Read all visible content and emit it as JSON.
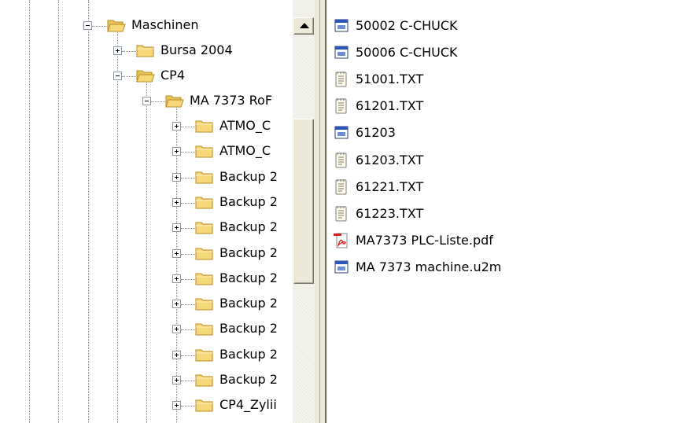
{
  "tree": {
    "top_node": {
      "label": "Maschinen",
      "icon": "folder-open-icon",
      "expanded": true
    },
    "level1": [
      {
        "label": "Bursa 2004",
        "icon": "folder-closed-icon",
        "expanded": false
      },
      {
        "label": "CP4",
        "icon": "folder-open-icon",
        "expanded": true
      }
    ],
    "level2": [
      {
        "label": "MA 7373 RoF",
        "icon": "folder-open-icon",
        "expanded": true
      }
    ],
    "level3": [
      {
        "label": "ATMO_C"
      },
      {
        "label": "ATMO_C"
      },
      {
        "label": "Backup 2"
      },
      {
        "label": "Backup 2"
      },
      {
        "label": "Backup 2"
      },
      {
        "label": "Backup 2"
      },
      {
        "label": "Backup 2"
      },
      {
        "label": "Backup 2"
      },
      {
        "label": "Backup 2"
      },
      {
        "label": "Backup 2"
      },
      {
        "label": "Backup 2"
      },
      {
        "label": "CP4_Zylii"
      }
    ]
  },
  "files": [
    {
      "name": "50002 C-CHUCK",
      "icon": "application-window-icon"
    },
    {
      "name": "50006 C-CHUCK",
      "icon": "application-window-icon"
    },
    {
      "name": "51001.TXT",
      "icon": "text-document-icon"
    },
    {
      "name": "61201.TXT",
      "icon": "text-document-icon"
    },
    {
      "name": "61203",
      "icon": "application-window-icon"
    },
    {
      "name": "61203.TXT",
      "icon": "text-document-icon"
    },
    {
      "name": "61221.TXT",
      "icon": "text-document-icon"
    },
    {
      "name": "61223.TXT",
      "icon": "text-document-icon"
    },
    {
      "name": "MA7373 PLC-Liste.pdf",
      "icon": "pdf-document-icon"
    },
    {
      "name": "MA 7373 machine.u2m",
      "icon": "application-window-icon"
    }
  ],
  "colors": {
    "folder_fill": "#f6d77a",
    "folder_stroke": "#b98a1d",
    "window_title_blue": "#2b57b8",
    "pdf_red": "#d81e1e",
    "scroll_face": "#ece9d8"
  }
}
